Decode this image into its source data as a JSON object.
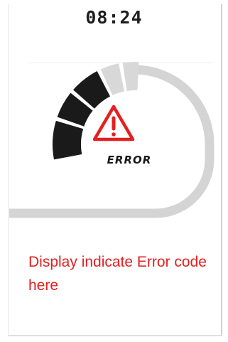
{
  "status_bar": {
    "time": "08:24"
  },
  "gauge": {
    "active_segments": 3,
    "total_segments": 6,
    "active_color": "#1a1a1a",
    "inactive_color": "#d8d8d8",
    "track_color": "#d4d4d4"
  },
  "alert": {
    "icon": "warning-triangle-icon",
    "icon_color": "#e32020",
    "label": "ERROR"
  },
  "annotation": {
    "text": "Display indicate Error code here",
    "color": "#e32020"
  }
}
